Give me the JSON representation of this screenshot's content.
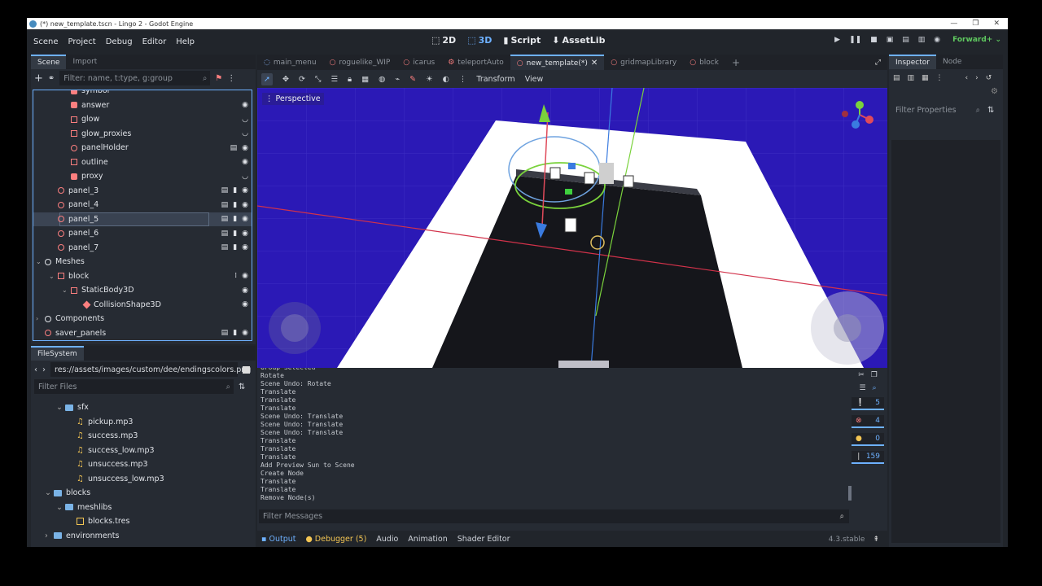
{
  "window": {
    "title": "(*) new_template.tscn - Lingo 2 - Godot Engine"
  },
  "menus": [
    "Scene",
    "Project",
    "Debug",
    "Editor",
    "Help"
  ],
  "workspaces": [
    {
      "label": "2D",
      "icon": "2d-icon"
    },
    {
      "label": "3D",
      "icon": "3d-icon",
      "active": true
    },
    {
      "label": "Script",
      "icon": "script-icon"
    },
    {
      "label": "AssetLib",
      "icon": "assetlib-icon"
    }
  ],
  "renderer": "Forward+",
  "scene_dock": {
    "tabs": [
      "Scene",
      "Import"
    ],
    "filter_placeholder": "Filter: name, t:type, g:group",
    "nodes": [
      {
        "label": "symbol",
        "indent": 2,
        "icon": "solid"
      },
      {
        "label": "answer",
        "indent": 2,
        "icon": "solid",
        "eye": true
      },
      {
        "label": "glow",
        "indent": 2,
        "icon": "boxr",
        "eye": "closed"
      },
      {
        "label": "glow_proxies",
        "indent": 2,
        "icon": "boxr",
        "eye": "closed"
      },
      {
        "label": "panelHolder",
        "indent": 2,
        "icon": "ring",
        "extra": true,
        "eye": true
      },
      {
        "label": "outline",
        "indent": 2,
        "icon": "boxr",
        "eye": true
      },
      {
        "label": "proxy",
        "indent": 2,
        "icon": "solid",
        "eye": "closed"
      },
      {
        "label": "panel_3",
        "indent": 1,
        "icon": "ring",
        "tools": true
      },
      {
        "label": "panel_4",
        "indent": 1,
        "icon": "ring",
        "tools": true
      },
      {
        "label": "panel_5",
        "indent": 1,
        "icon": "ring",
        "tools": true,
        "selected": true
      },
      {
        "label": "panel_6",
        "indent": 1,
        "icon": "ring",
        "tools": true
      },
      {
        "label": "panel_7",
        "indent": 1,
        "icon": "ring",
        "tools": true
      },
      {
        "label": "Meshes",
        "indent": 0,
        "icon": "ringw",
        "expand": "down"
      },
      {
        "label": "block",
        "indent": 1,
        "icon": "boxr",
        "expand": "down",
        "grid": true
      },
      {
        "label": "StaticBody3D",
        "indent": 2,
        "icon": "boxr",
        "expand": "down",
        "eye": true
      },
      {
        "label": "CollisionShape3D",
        "indent": 3,
        "icon": "mesh",
        "eye": true
      },
      {
        "label": "Components",
        "indent": 0,
        "icon": "ringw",
        "expand": "right"
      },
      {
        "label": "saver_panels",
        "indent": 0,
        "icon": "ring",
        "tools": true
      }
    ]
  },
  "filesystem": {
    "tab": "FileSystem",
    "path": "res://assets/images/custom/dee/endingscolors.png",
    "filter_placeholder": "Filter Files",
    "items": [
      {
        "label": "sfx",
        "type": "folder",
        "indent": 1
      },
      {
        "label": "pickup.mp3",
        "type": "audio",
        "indent": 2
      },
      {
        "label": "success.mp3",
        "type": "audio",
        "indent": 2
      },
      {
        "label": "success_low.mp3",
        "type": "audio",
        "indent": 2
      },
      {
        "label": "unsuccess.mp3",
        "type": "audio",
        "indent": 2
      },
      {
        "label": "unsuccess_low.mp3",
        "type": "audio",
        "indent": 2
      },
      {
        "label": "blocks",
        "type": "folder",
        "indent": 0
      },
      {
        "label": "meshlibs",
        "type": "folder",
        "indent": 1
      },
      {
        "label": "blocks.tres",
        "type": "res",
        "indent": 2
      },
      {
        "label": "environments",
        "type": "folder",
        "indent": 0,
        "collapsed": true
      }
    ]
  },
  "scene_tabs": [
    {
      "label": "main_menu"
    },
    {
      "label": "roguelike_WIP"
    },
    {
      "label": "icarus"
    },
    {
      "label": "teleportAuto"
    },
    {
      "label": "new_template(*)",
      "active": true
    },
    {
      "label": "gridmapLibrary"
    },
    {
      "label": "block"
    }
  ],
  "viewport_toolbar": {
    "transform": "Transform",
    "view": "View"
  },
  "viewport": {
    "mode": "Perspective"
  },
  "output": {
    "lines": [
      "Group Selected",
      "Rotate",
      "Scene Undo: Rotate",
      "Translate",
      "Translate",
      "Translate",
      "Scene Undo: Translate",
      "Scene Undo: Translate",
      "Scene Undo: Translate",
      "Translate",
      "Translate",
      "Translate",
      "Add Preview Sun to Scene",
      "Create Node",
      "Translate",
      "Translate",
      "Remove Node(s)"
    ],
    "filter_placeholder": "Filter Messages",
    "counts": {
      "messages": "5",
      "errors": "4",
      "warnings": "0",
      "editor": "159"
    }
  },
  "bottom_tabs": [
    "Output",
    "Debugger (5)",
    "Audio",
    "Animation",
    "Shader Editor"
  ],
  "version": "4.3.stable",
  "inspector": {
    "tabs": [
      "Inspector",
      "Node"
    ],
    "filter_placeholder": "Filter Properties"
  }
}
